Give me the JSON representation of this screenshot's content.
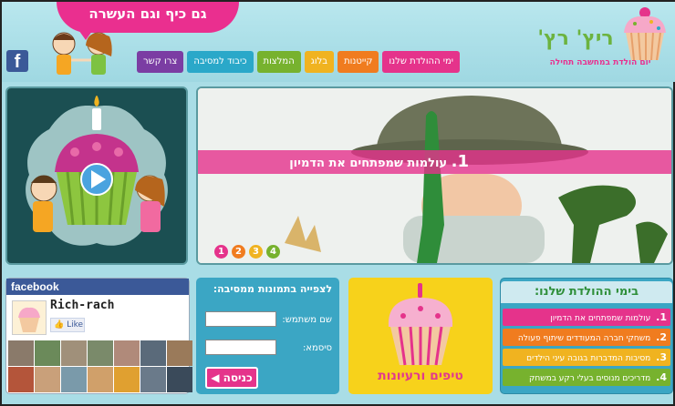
{
  "header": {
    "slogan": "גם כיף וגם העשרה",
    "logo_title": "ריץ' רץ'",
    "logo_subtitle": "יום הולדת במחשבה תחילה",
    "fb_icon_letter": "f"
  },
  "nav": {
    "items": [
      {
        "label": "צרו קשר",
        "color": "#7b3da3"
      },
      {
        "label": "כיבוד למסיבה",
        "color": "#2aa8c9"
      },
      {
        "label": "המלצות",
        "color": "#77b22e"
      },
      {
        "label": "בלוג",
        "color": "#f0b320"
      },
      {
        "label": "קייטנות",
        "color": "#f07c1f"
      },
      {
        "label": "ימי ההולדת שלנו",
        "color": "#e5338b"
      }
    ]
  },
  "banner": {
    "caption_number": "1.",
    "caption": "עולמות שמפתחים את הדמיון",
    "dots": [
      {
        "label": "1",
        "color": "#e5338b"
      },
      {
        "label": "2",
        "color": "#f07c1f"
      },
      {
        "label": "3",
        "color": "#f0b320"
      },
      {
        "label": "4",
        "color": "#77b22e"
      }
    ]
  },
  "facebook": {
    "header": "facebook",
    "page_name": "Rich-rach",
    "like_label": "Like"
  },
  "login": {
    "title": "לצפייה בתמונות ממסיבה:",
    "username_label": "שם משתמש:",
    "password_label": "סיסמא:",
    "submit_label": "כניסה"
  },
  "tips": {
    "label": "טיפים ורעיונות"
  },
  "birthdays": {
    "title": "בימי ההולדת שלנו:",
    "items": [
      {
        "num": "1.",
        "text": "עולמות שמפתחים את הדמיון",
        "color": "#e5338b"
      },
      {
        "num": "2.",
        "text": "משחקי חברה המעודדים שיתוף פעולה",
        "color": "#f07c1f"
      },
      {
        "num": "3.",
        "text": "מסיבות המדברות בגובה עיני הילדים",
        "color": "#f0b320"
      },
      {
        "num": "4.",
        "text": "מדריכים מנוסים בעלי רקע במשחק",
        "color": "#77b22e"
      }
    ]
  }
}
